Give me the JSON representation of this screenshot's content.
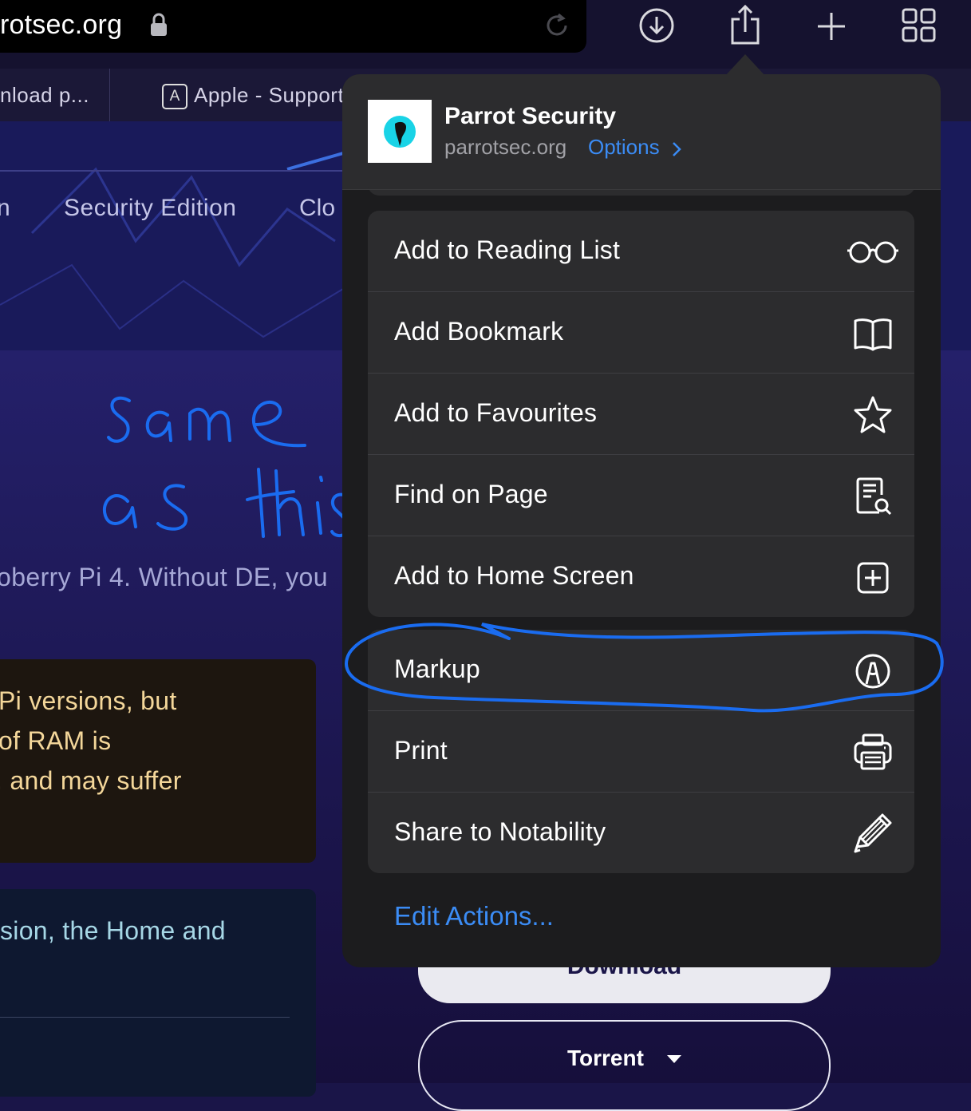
{
  "toolbar": {
    "url": "rotsec.org",
    "icons": [
      "lock-icon",
      "reload-icon",
      "download-icon",
      "share-icon",
      "plus-icon",
      "tabs-grid-icon"
    ]
  },
  "tabs": [
    {
      "label": "nload p..."
    },
    {
      "badge": "A",
      "label": "Apple - Support"
    }
  ],
  "page": {
    "nav": [
      "n",
      "Security Edition",
      "Clo"
    ],
    "body_text": "oberry Pi 4. Without DE, you",
    "warning_lines": [
      " Pi versions, but",
      " of RAM is",
      ", and may suffer"
    ],
    "info_line": "sion, the Home and",
    "download_label": "Download",
    "torrent_label": "Torrent"
  },
  "sheet": {
    "site": {
      "title": "Parrot Security",
      "host": "parrotsec.org",
      "options": "Options"
    },
    "group1": [
      {
        "label": "Add to Reading List",
        "icon": "glasses-icon"
      },
      {
        "label": "Add Bookmark",
        "icon": "book-icon"
      },
      {
        "label": "Add to Favourites",
        "icon": "star-icon"
      },
      {
        "label": "Find on Page",
        "icon": "find-page-icon"
      },
      {
        "label": "Add to Home Screen",
        "icon": "add-square-icon"
      }
    ],
    "group2": [
      {
        "label": "Markup",
        "icon": "markup-icon"
      },
      {
        "label": "Print",
        "icon": "printer-icon"
      },
      {
        "label": "Share to Notability",
        "icon": "pencil-icon"
      }
    ],
    "edit_actions": "Edit Actions..."
  },
  "colors": {
    "accent_blue": "#3b8cf5",
    "sheet_bg": "#1c1c1e",
    "row_bg": "#2c2c2e",
    "ink_blue": "#1a6cf0"
  }
}
